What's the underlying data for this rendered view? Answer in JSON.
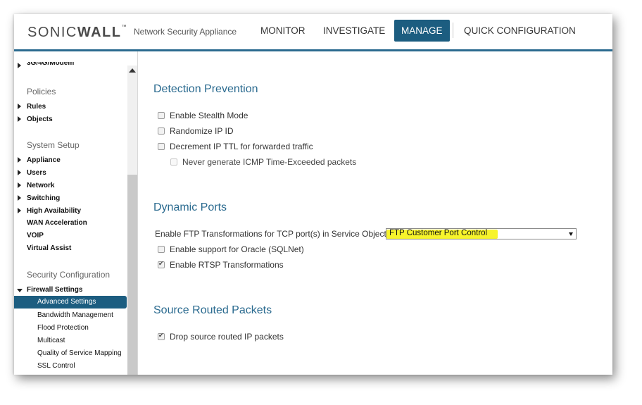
{
  "header": {
    "logo_prefix": "SONIC",
    "logo_suffix": "WALL",
    "logo_tm": "™",
    "subtitle": "Network Security Appliance",
    "nav": {
      "monitor": "MONITOR",
      "investigate": "INVESTIGATE",
      "manage": "MANAGE",
      "quick_config": "QUICK CONFIGURATION"
    },
    "active_nav": "MANAGE"
  },
  "sidebar": {
    "top_item": "3G/4G/Modem",
    "policies_heading": "Policies",
    "policies": [
      "Rules",
      "Objects"
    ],
    "system_heading": "System Setup",
    "system": [
      "Appliance",
      "Users",
      "Network",
      "Switching",
      "High Availability",
      "WAN Acceleration",
      "VOIP",
      "Virtual Assist"
    ],
    "security_heading": "Security Configuration",
    "firewall_settings": "Firewall Settings",
    "firewall_sub": [
      "Advanced Settings",
      "Bandwidth Management",
      "Flood Protection",
      "Multicast",
      "Quality of Service Mapping",
      "SSL Control"
    ],
    "active_item": "Advanced Settings"
  },
  "main": {
    "detection": {
      "title": "Detection Prevention",
      "options": [
        {
          "label": "Enable Stealth Mode",
          "checked": false
        },
        {
          "label": "Randomize IP ID",
          "checked": false
        },
        {
          "label": "Decrement IP TTL for forwarded traffic",
          "checked": false
        },
        {
          "label": "Never generate ICMP Time-Exceeded packets",
          "checked": false,
          "disabled": true
        }
      ]
    },
    "dynamic_ports": {
      "title": "Dynamic Ports",
      "ftp_label": "Enable FTP Transformations for TCP port(s) in Service Object:",
      "ftp_value": "FTP Customer Port Control",
      "options": [
        {
          "label": "Enable support for Oracle (SQLNet)",
          "checked": false
        },
        {
          "label": "Enable RTSP Transformations",
          "checked": true
        }
      ]
    },
    "source_routed": {
      "title": "Source Routed Packets",
      "options": [
        {
          "label": "Drop source routed IP packets",
          "checked": true
        }
      ]
    }
  },
  "colors": {
    "brand_blue": "#1c5d80",
    "section_title": "#2a6a8f",
    "highlight_yellow": "#f7f42b"
  }
}
